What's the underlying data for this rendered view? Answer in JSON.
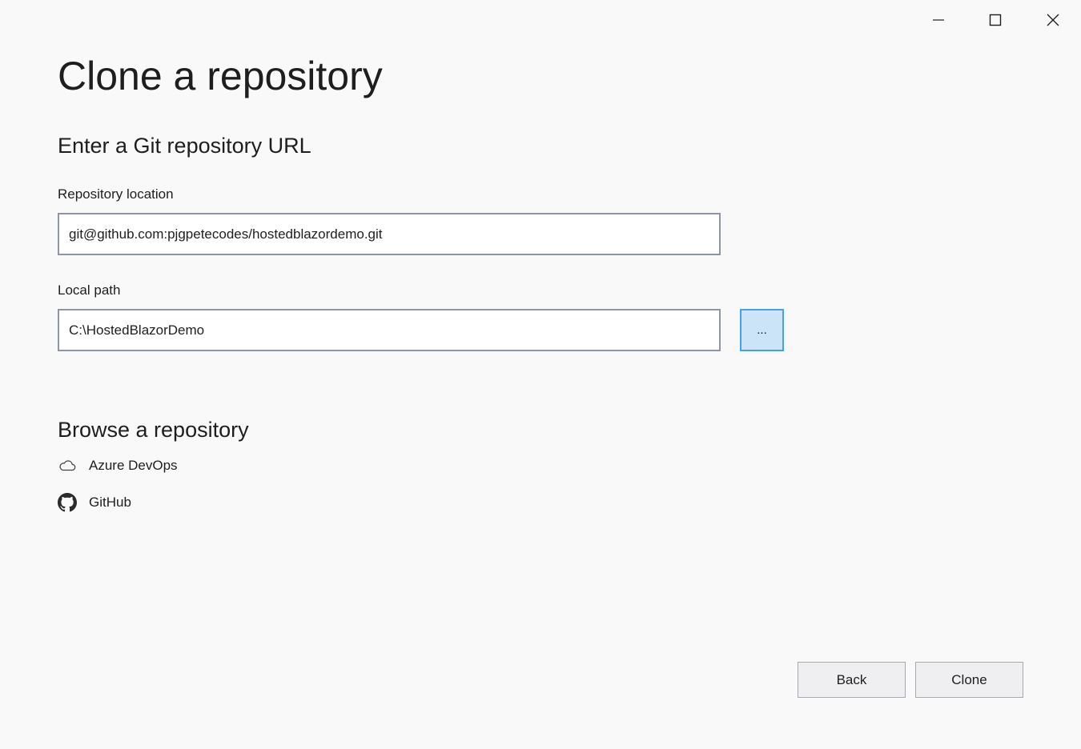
{
  "window_controls": {
    "minimize_icon": "minimize-icon",
    "maximize_icon": "maximize-icon",
    "close_icon": "close-icon"
  },
  "page": {
    "title": "Clone a repository"
  },
  "url_section": {
    "heading": "Enter a Git repository URL",
    "repo_location_label": "Repository location",
    "repo_location_value": "git@github.com:pjgpetecodes/hostedblazordemo.git",
    "local_path_label": "Local path",
    "local_path_value": "C:\\HostedBlazorDemo",
    "browse_button_label": "..."
  },
  "browse_section": {
    "heading": "Browse a repository",
    "items": [
      {
        "label": "Azure DevOps",
        "icon": "cloud-icon"
      },
      {
        "label": "GitHub",
        "icon": "github-icon"
      }
    ]
  },
  "footer": {
    "back_label": "Back",
    "clone_label": "Clone"
  },
  "colors": {
    "background": "#f9f9f9",
    "input_border": "#8f95a3",
    "browse_button_fill": "#cce4f7",
    "browse_button_border": "#4aa0e6",
    "footer_button_fill": "#efeff2"
  }
}
